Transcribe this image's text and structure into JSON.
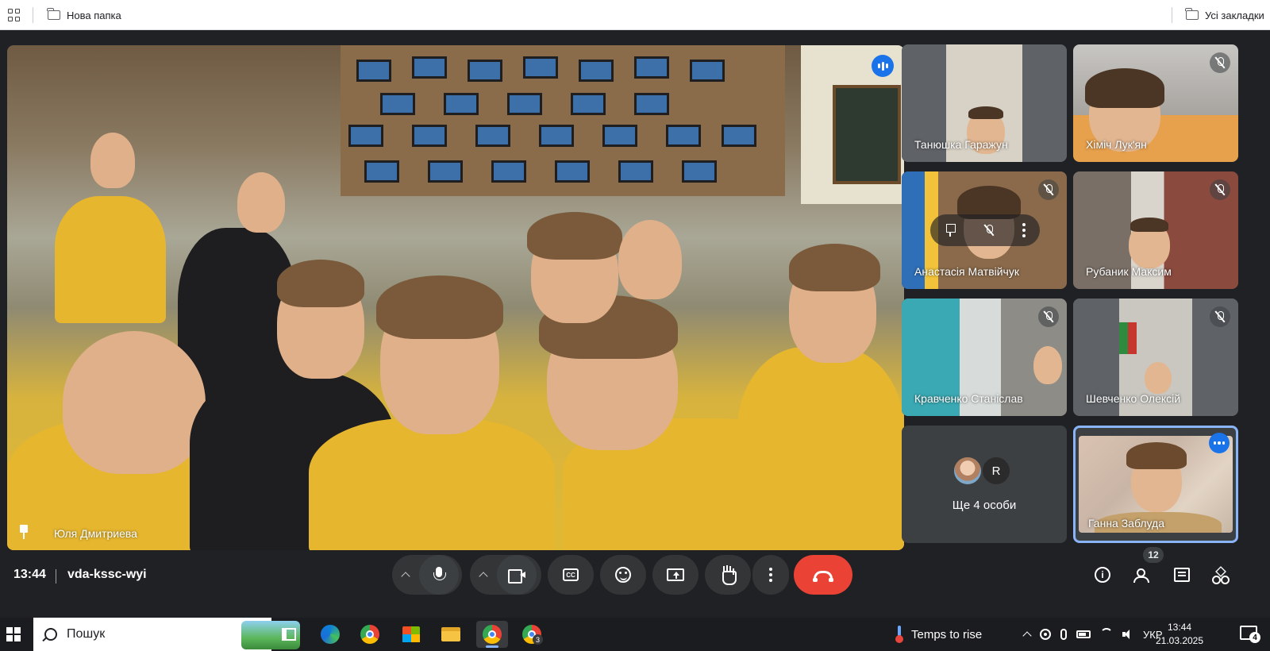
{
  "bookmarks": {
    "folder_label": "Нова папка",
    "all_bookmarks_label": "Усі закладки"
  },
  "main_tile": {
    "name": "Юля Дмитриева",
    "pinned": true,
    "speaking": true
  },
  "participants": [
    {
      "name": "Танюшка Гаражун",
      "muted": false
    },
    {
      "name": "Хіміч Лук'ян",
      "muted": true
    },
    {
      "name": "Анастасія Матвійчук",
      "muted": true
    },
    {
      "name": "Рубаник Максим",
      "muted": true
    },
    {
      "name": "Кравченко Станіслав",
      "muted": true
    },
    {
      "name": "Шевченко Олексій",
      "muted": true
    }
  ],
  "more_tile": {
    "label": "Ще 4 особи",
    "avatar_letter": "R"
  },
  "self_tile": {
    "name": "Ганна Заблуда"
  },
  "meeting": {
    "time": "13:44",
    "code": "vda-kssc-wyi",
    "people_count": "12"
  },
  "controls": {
    "captions_glyph": "CC",
    "info_glyph": "i"
  },
  "taskbar": {
    "search_placeholder": "Пошук",
    "weather_text": "Temps to rise",
    "language": "УКР",
    "time": "13:44",
    "date": "21.03.2025",
    "chrome_badge": "3",
    "notifications_count": "4"
  },
  "colors": {
    "meet_bg": "#202124",
    "accent_blue": "#1a73e8",
    "hangup_red": "#ea4335",
    "self_border": "#8ab4f8"
  }
}
